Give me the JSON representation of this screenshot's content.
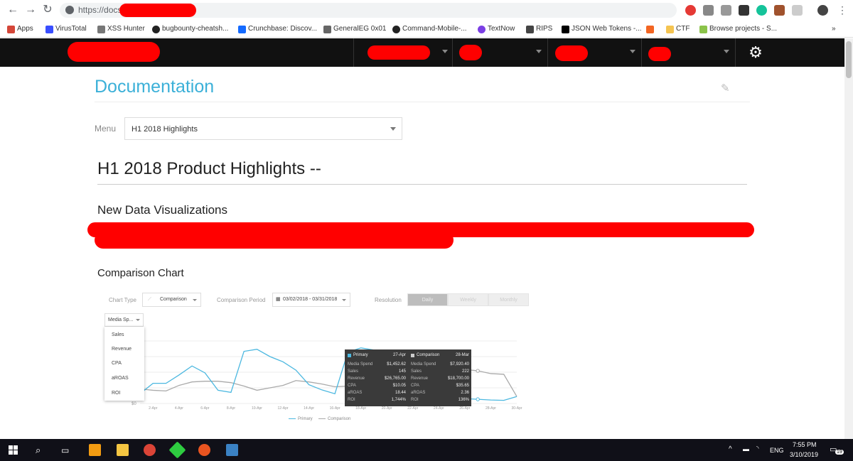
{
  "browser": {
    "url": "https://docs",
    "bookmarks": [
      {
        "label": "Apps",
        "color": "#d44638"
      },
      {
        "label": "VirusTotal",
        "color": "#394eff"
      },
      {
        "label": "XSS Hunter",
        "color": "#777"
      },
      {
        "label": "bugbounty-cheatsh...",
        "color": "#222"
      },
      {
        "label": "Crunchbase: Discov...",
        "color": "#146aff"
      },
      {
        "label": "GeneralEG 0x01",
        "color": "#666"
      },
      {
        "label": "Command-Mobile-...",
        "color": "#222"
      },
      {
        "label": "TextNow",
        "color": "#7b3fe4"
      },
      {
        "label": "RIPS",
        "color": "#444"
      },
      {
        "label": "JSON Web Tokens -...",
        "color": "#000"
      },
      {
        "label": "",
        "color": "#f26522"
      },
      {
        "label": "CTF",
        "color": "#f5c451"
      },
      {
        "label": "Browse projects - S...",
        "color": "#8bc34a"
      }
    ],
    "more_bookmarks": "»"
  },
  "header": {
    "gear_icon": "gear-icon"
  },
  "page": {
    "doc_title": "Documentation",
    "menu_label": "Menu",
    "menu_value": "H1 2018 Highlights",
    "heading": "H1 2018 Product Highlights --",
    "subheading": "New Data Visualizations",
    "chart_section": "Comparison Chart"
  },
  "chart_controls": {
    "chart_type_label": "Chart Type",
    "chart_type_value": "Comparison",
    "period_label": "Comparison Period",
    "period_value": "03/02/2018 - 03/31/2018",
    "resolution_label": "Resolution",
    "resolution_options": [
      "Daily",
      "Weekly",
      "Monthly"
    ],
    "metric_value": "Media Sp...",
    "metric_options": [
      "Sales",
      "Revenue",
      "CPA",
      "aROAS",
      "ROI"
    ]
  },
  "chart_data": {
    "type": "line",
    "x": [
      "1-Apr",
      "2-Apr",
      "3-Apr",
      "4-Apr",
      "5-Apr",
      "6-Apr",
      "7-Apr",
      "8-Apr",
      "9-Apr",
      "10-Apr",
      "11-Apr",
      "12-Apr",
      "13-Apr",
      "14-Apr",
      "15-Apr",
      "16-Apr",
      "17-Apr",
      "18-Apr",
      "19-Apr",
      "20-Apr",
      "21-Apr",
      "22-Apr",
      "23-Apr",
      "24-Apr",
      "25-Apr",
      "26-Apr",
      "27-Apr",
      "28-Apr",
      "29-Apr",
      "30-Apr"
    ],
    "tick_labels": [
      "2-Apr",
      "4-Apr",
      "6-Apr",
      "8-Apr",
      "10-Apr",
      "12-Apr",
      "14-Apr",
      "16-Apr",
      "18-Apr",
      "20-Apr",
      "22-Apr",
      "24-Apr",
      "26-Apr",
      "28-Apr",
      "30-Apr"
    ],
    "y_tick_label": "$0",
    "series": [
      {
        "name": "Primary",
        "color": "#4cb8e0",
        "values": [
          280,
          580,
          580,
          820,
          1080,
          880,
          380,
          320,
          1500,
          1560,
          1350,
          1200,
          960,
          540,
          390,
          280,
          1480,
          1600,
          1540,
          1300,
          1100,
          820,
          540,
          300,
          180,
          140,
          120,
          100,
          90,
          200
        ]
      },
      {
        "name": "Comparison",
        "color": "#aaaaaa",
        "values": [
          420,
          380,
          360,
          520,
          620,
          640,
          640,
          600,
          500,
          380,
          450,
          520,
          660,
          620,
          560,
          480,
          500,
          530,
          540,
          520,
          500,
          560,
          660,
          820,
          920,
          980,
          940,
          860,
          840,
          200
        ]
      }
    ],
    "ylim": [
      0,
      1800
    ],
    "grid": true,
    "legend": "bottom-center",
    "tooltip": {
      "primary": {
        "name": "Primary",
        "date": "27-Apr",
        "rows": [
          [
            "Media Spend",
            "$1,452.62"
          ],
          [
            "Sales",
            "145"
          ],
          [
            "Revenue",
            "$26,765.00"
          ],
          [
            "CPA",
            "$10.05"
          ],
          [
            "aROAS",
            "18.44"
          ],
          [
            "ROI",
            "1,744%"
          ]
        ]
      },
      "comparison": {
        "name": "Comparison",
        "date": "28-Mar",
        "rows": [
          [
            "Media Spend",
            "$7,920.40"
          ],
          [
            "Sales",
            "222"
          ],
          [
            "Revenue",
            "$18,700.00"
          ],
          [
            "CPA",
            "$35.65"
          ],
          [
            "aROAS",
            "2.36"
          ],
          [
            "ROI",
            "136%"
          ]
        ]
      }
    }
  },
  "legend_labels": {
    "primary": "Primary",
    "comparison": "Comparison"
  },
  "taskbar": {
    "time": "7:55 PM",
    "date": "3/10/2019",
    "lang": "ENG",
    "notifications": "19"
  }
}
